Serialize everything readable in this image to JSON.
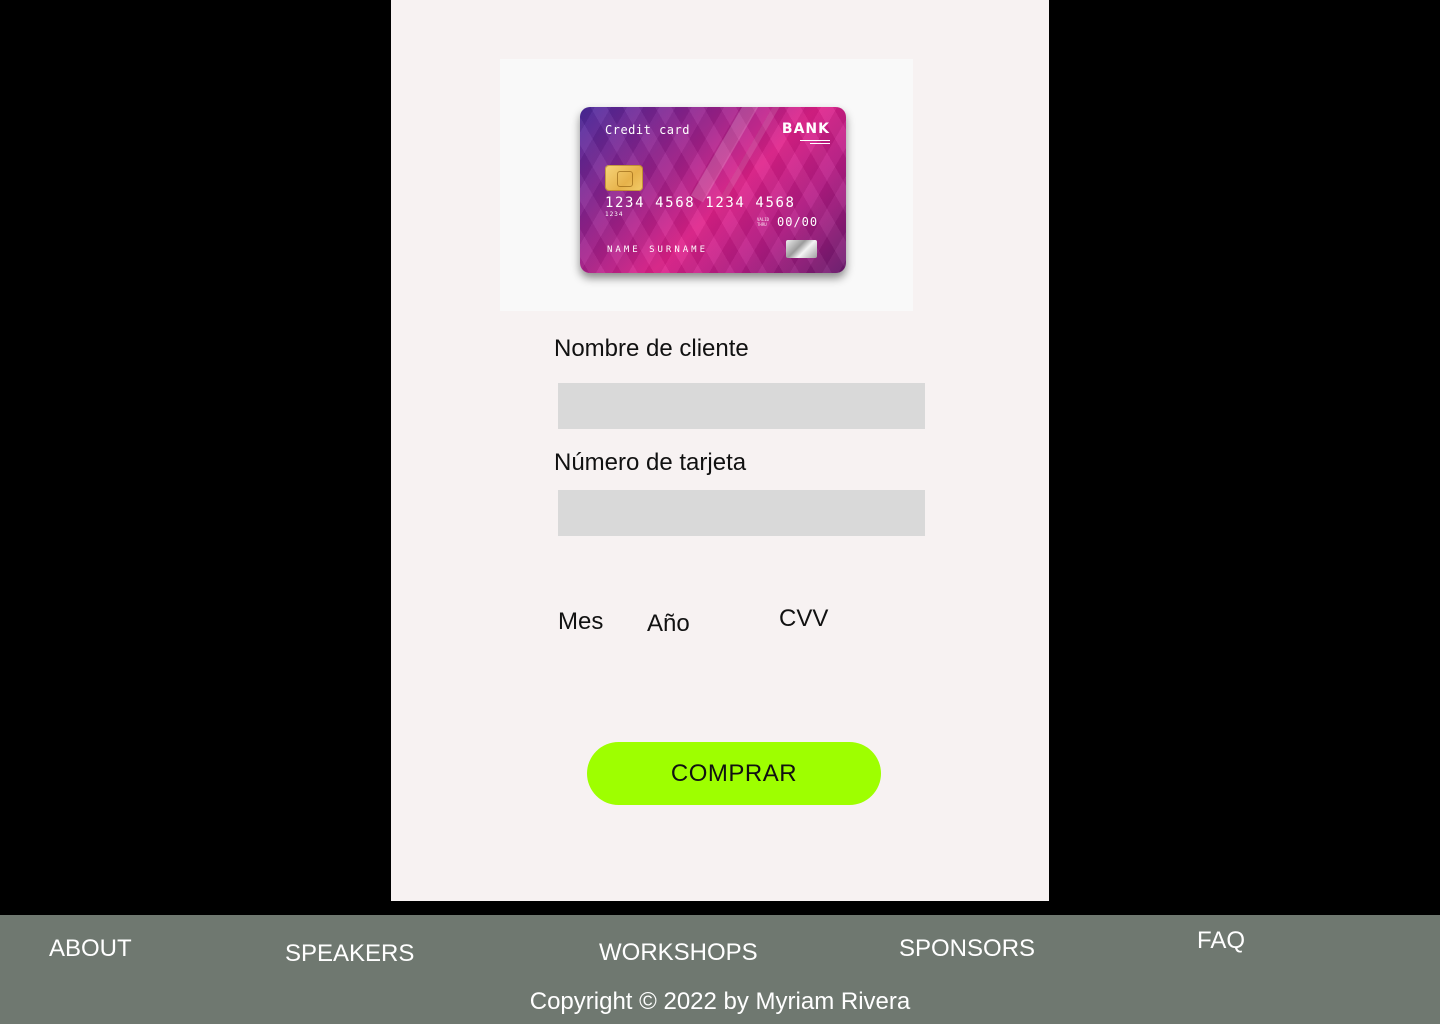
{
  "card": {
    "title": "Credit card",
    "bank": "BANK",
    "number": "1234  4568 1234  4568",
    "small_number": "1234",
    "valid_label_1": "VALID",
    "valid_label_2": "THRU",
    "expiry": "00/00",
    "holder": "NAME SURNAME"
  },
  "form": {
    "name_label": "Nombre de cliente",
    "name_value": "",
    "card_number_label": "Número de tarjeta",
    "card_number_value": "",
    "month_label": "Mes",
    "year_label": "Año",
    "cvv_label": "CVV",
    "submit_label": "COMPRAR"
  },
  "footer": {
    "nav": [
      "ABOUT",
      "SPEAKERS",
      "WORKSHOPS",
      "SPONSORS",
      "FAQ"
    ],
    "copyright": "Copyright © 2022 by Myriam Rivera"
  },
  "colors": {
    "background": "#000000",
    "panel": "#f7f2f2",
    "input": "#d9d9d9",
    "button": "#9eff00",
    "footer": "#6f7870"
  }
}
